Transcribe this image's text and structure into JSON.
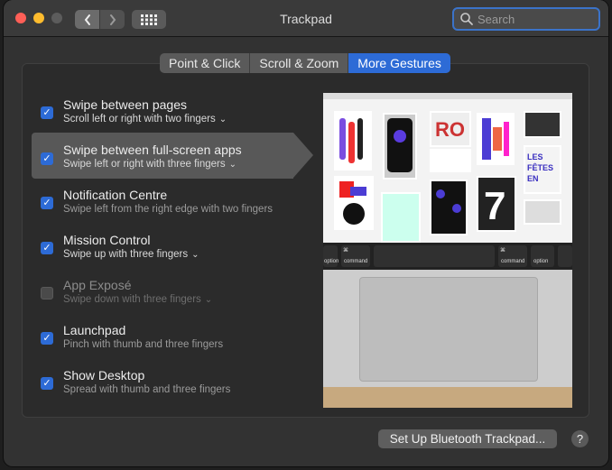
{
  "window": {
    "title": "Trackpad"
  },
  "search": {
    "placeholder": "Search"
  },
  "tabs": [
    {
      "label": "Point & Click",
      "active": false
    },
    {
      "label": "Scroll & Zoom",
      "active": false
    },
    {
      "label": "More Gestures",
      "active": true
    }
  ],
  "gestures": [
    {
      "title": "Swipe between pages",
      "subtitle": "Scroll left or right with two fingers",
      "checked": true,
      "has_menu": true,
      "enabled": true
    },
    {
      "title": "Swipe between full-screen apps",
      "subtitle": "Swipe left or right with three fingers",
      "checked": true,
      "has_menu": true,
      "enabled": true,
      "selected": true
    },
    {
      "title": "Notification Centre",
      "subtitle": "Swipe left from the right edge with two fingers",
      "checked": true,
      "has_menu": false,
      "enabled": true
    },
    {
      "title": "Mission Control",
      "subtitle": "Swipe up with three fingers",
      "checked": true,
      "has_menu": true,
      "enabled": true
    },
    {
      "title": "App Exposé",
      "subtitle": "Swipe down with three fingers",
      "checked": false,
      "has_menu": true,
      "enabled": false
    },
    {
      "title": "Launchpad",
      "subtitle": "Pinch with thumb and three fingers",
      "checked": true,
      "has_menu": false,
      "enabled": true
    },
    {
      "title": "Show Desktop",
      "subtitle": "Spread with thumb and three fingers",
      "checked": true,
      "has_menu": false,
      "enabled": true
    }
  ],
  "preview": {
    "keys": {
      "option_left": "option",
      "command_left": "command",
      "command_right": "command",
      "option_right": "option"
    }
  },
  "buttons": {
    "setup": "Set Up Bluetooth Trackpad...",
    "help": "?"
  },
  "colors": {
    "accent": "#2d6bd6"
  }
}
